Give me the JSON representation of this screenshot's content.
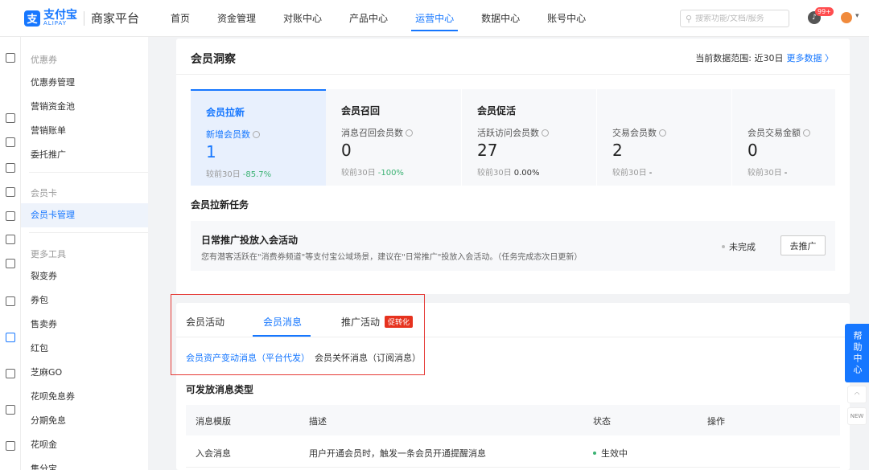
{
  "brand": {
    "logo_cn": "支付宝",
    "logo_en": "ALIPAY",
    "title": "商家平台"
  },
  "topnav": [
    {
      "label": "首页"
    },
    {
      "label": "资金管理"
    },
    {
      "label": "对账中心"
    },
    {
      "label": "产品中心"
    },
    {
      "label": "运营中心",
      "active": true
    },
    {
      "label": "数据中心"
    },
    {
      "label": "账号中心"
    }
  ],
  "search": {
    "placeholder": "搜索功能/文档/服务"
  },
  "notifications": {
    "badge": "99+"
  },
  "sidebar": {
    "group_coupon": "优惠券",
    "items_coupon": [
      "优惠券管理",
      "营销资金池",
      "营销账单",
      "委托推广"
    ],
    "group_card": "会员卡",
    "items_card": [
      "会员卡管理"
    ],
    "group_tools": "更多工具",
    "items_tools": [
      "裂变券",
      "券包",
      "售卖券",
      "红包",
      "芝麻GO",
      "花呗免息券",
      "分期免息",
      "花呗金",
      "集分宝"
    ]
  },
  "insight": {
    "title": "会员洞察",
    "range_label": "当前数据范围: 近30日",
    "more_label": "更多数据 〉",
    "stats": [
      {
        "heading": "会员拉新",
        "label": "新增会员数",
        "value": "1",
        "cmp_label": "较前30日",
        "cmp_value": "-85.7%"
      },
      {
        "heading": "会员召回",
        "label": "消息召回会员数",
        "value": "0",
        "cmp_label": "较前30日",
        "cmp_value": "-100%"
      },
      {
        "heading": "会员促活",
        "label": "活跃访问会员数",
        "value": "27",
        "cmp_label": "较前30日",
        "cmp_value": "0.00%"
      },
      {
        "heading": "",
        "label": "交易会员数",
        "value": "2",
        "cmp_label": "较前30日",
        "cmp_value": "-"
      },
      {
        "heading": "",
        "label": "会员交易金额",
        "value": "0",
        "cmp_label": "较前30日",
        "cmp_value": "-"
      }
    ],
    "task_section_title": "会员拉新任务",
    "task": {
      "name": "日常推广投放入会活动",
      "desc": "您有潜客活跃在\"消费券频道\"等支付宝公域场景，建议在\"日常推广\"投放入会活动。（任务完成态次日更新）",
      "status": "未完成",
      "button": "去推广"
    }
  },
  "messages": {
    "tabs": [
      "会员活动",
      "会员消息",
      "推广活动"
    ],
    "promo_tag": "促转化",
    "subtabs": [
      "会员资产变动消息（平台代发）",
      "会员关怀消息（订阅消息）"
    ],
    "section_title": "可发放消息类型",
    "columns": [
      "消息模版",
      "描述",
      "状态",
      "操作"
    ],
    "rows": [
      {
        "template": "入会消息",
        "desc": "用户开通会员时，触发一条会员开通提醒消息",
        "status": "生效中"
      }
    ]
  },
  "float": {
    "help": "帮助中心",
    "new_label": "NEW"
  }
}
